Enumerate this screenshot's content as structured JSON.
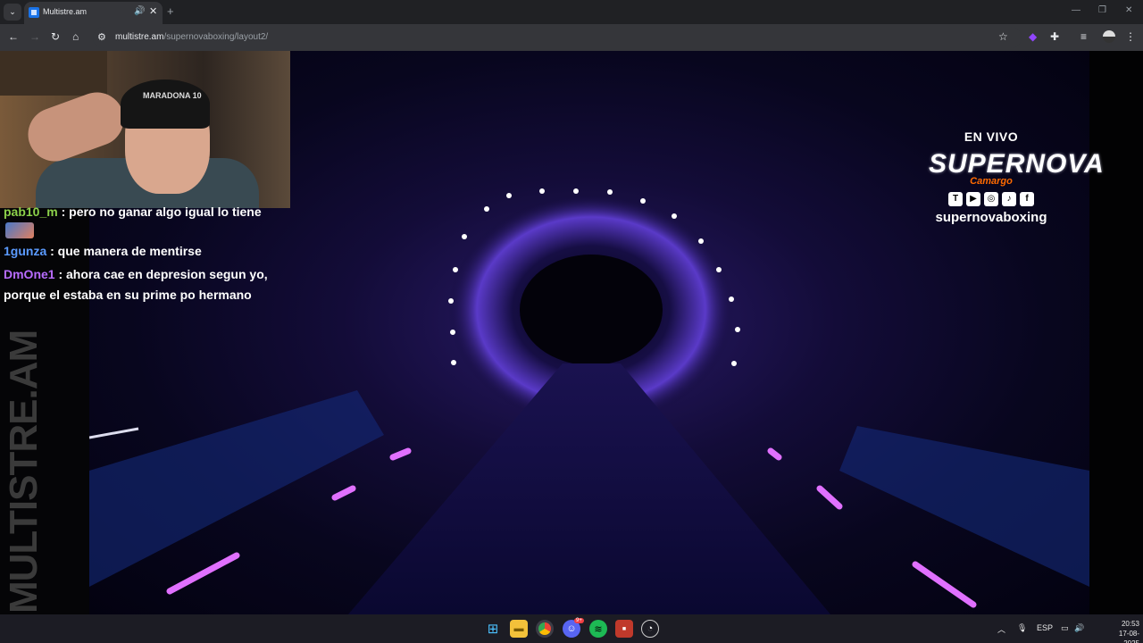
{
  "browser": {
    "tab_title": "Multistre.am",
    "url_host": "multistre.am",
    "url_path": "/supernovaboxing/layout2/"
  },
  "site_brand": "MULTISTRE.AM",
  "webcam": {
    "cap_text": "MARADONA 10"
  },
  "chat": [
    {
      "user": "pab10_m",
      "message": " : pero no ganar algo igual lo tiene",
      "color": "#8cd14a"
    },
    {
      "user": "1gunza",
      "message": " : que manera de mentirse",
      "color": "#5b9bff"
    },
    {
      "user": "DmOne1",
      "message": " : ahora cae en depresion segun yo,",
      "color": "#b86cff"
    },
    {
      "user": "",
      "message": "porque el estaba en su prime po hermano",
      "color": "#ffffff"
    }
  ],
  "overlay": {
    "live": "EN VIVO",
    "brand": "SUPERNOVA",
    "sponsor": "Camargo",
    "handle": "supernovaboxing"
  },
  "taskbar": {
    "language": "ESP",
    "time": "20:53",
    "date": "17-08-2025",
    "discord_badge": "9+"
  },
  "colors": {
    "chrome_dark": "#202124",
    "chrome_toolbar": "#35363a",
    "stream_purple": "#2a1a6a"
  }
}
